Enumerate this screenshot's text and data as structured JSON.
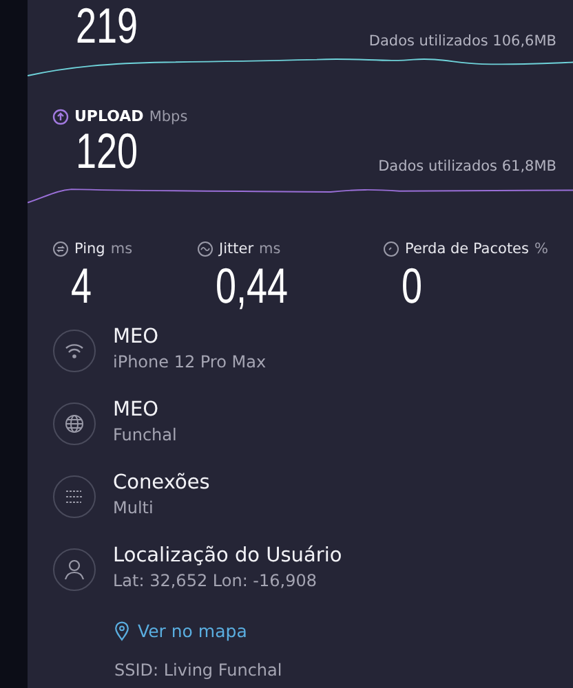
{
  "download": {
    "value": "219",
    "data_used": "Dados utilizados 106,6MB"
  },
  "upload": {
    "label": "UPLOAD",
    "unit": "Mbps",
    "value": "120",
    "data_used": "Dados utilizados 61,8MB"
  },
  "metrics": [
    {
      "kind": "ping",
      "label": "Ping",
      "unit": "ms",
      "value": "4"
    },
    {
      "kind": "jitter",
      "label": "Jitter",
      "unit": "ms",
      "value": "0,44"
    },
    {
      "kind": "loss",
      "label": "Perda de Pacotes",
      "unit": "%",
      "value": "0"
    }
  ],
  "details": [
    {
      "kind": "wifi",
      "title": "MEO",
      "subtitle": "iPhone 12 Pro Max"
    },
    {
      "kind": "globe",
      "title": "MEO",
      "subtitle": "Funchal"
    },
    {
      "kind": "connections",
      "title": "Conexões",
      "subtitle": "Multi"
    },
    {
      "kind": "user",
      "title": "Localização do Usuário",
      "subtitle": "Lat: 32,652  Lon: -16,908"
    }
  ],
  "map_link": "Ver no mapa",
  "ssid": "SSID: Living Funchal"
}
